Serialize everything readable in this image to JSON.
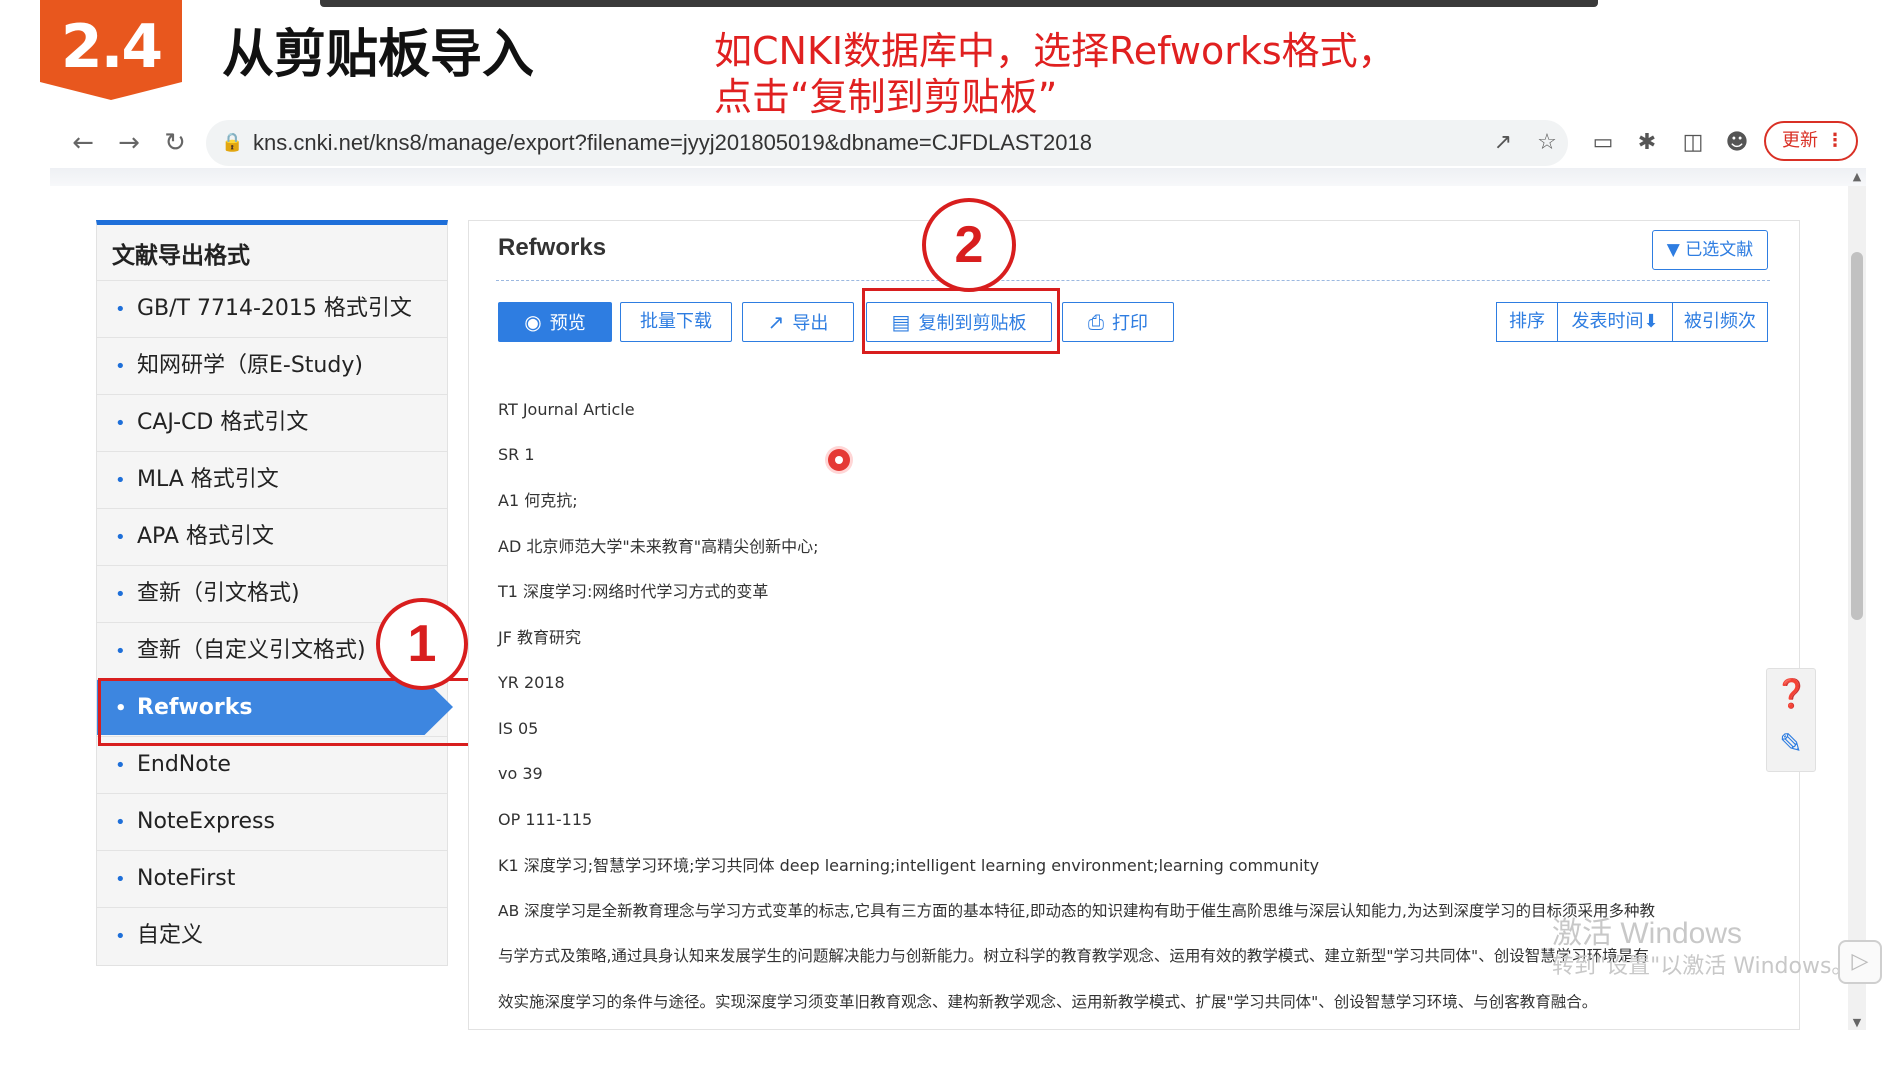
{
  "slide": {
    "badge": "2.4",
    "title": "从剪贴板导入",
    "note_line1": "如CNKI数据库中，选择Refworks格式，",
    "note_line2": "点击“复制到剪贴板”"
  },
  "browser": {
    "url": "kns.cnki.net/kns8/manage/export?filename=jyyj201805019&dbname=CJFDLAST2018",
    "update_label": "更新",
    "menu_glyph": "⋮",
    "icons": [
      "back-icon",
      "forward-icon",
      "reload-icon",
      "lock-icon",
      "share-icon",
      "star-icon",
      "doc-icon",
      "extensions-icon",
      "sidepanel-icon",
      "profile-icon"
    ]
  },
  "sidebar": {
    "heading": "文献导出格式",
    "items": [
      {
        "label": "GB/T 7714-2015 格式引文"
      },
      {
        "label": "知网研学（原E-Study)"
      },
      {
        "label": "CAJ-CD 格式引文"
      },
      {
        "label": "MLA 格式引文"
      },
      {
        "label": "APA 格式引文"
      },
      {
        "label": "查新（引文格式)"
      },
      {
        "label": "查新（自定义引文格式)"
      },
      {
        "label": "Refworks",
        "active": true
      },
      {
        "label": "EndNote"
      },
      {
        "label": "NoteExpress"
      },
      {
        "label": "NoteFirst"
      },
      {
        "label": "自定义"
      }
    ]
  },
  "annotations": {
    "step1": "1",
    "step2": "2"
  },
  "main": {
    "title": "Refworks",
    "selected_docs": "已选文献",
    "toolbar": {
      "preview": "预览",
      "batch_download": "批量下载",
      "export": "导出",
      "copy_clipboard": "复制到剪贴板",
      "print": "打印"
    },
    "sort": {
      "label": "排序",
      "by_date": "发表时间",
      "by_cited": "被引频次"
    },
    "record": [
      "RT Journal Article",
      "SR 1",
      "A1 何克抗;",
      "AD 北京师范大学\"未来教育\"高精尖创新中心;",
      "T1 深度学习:网络时代学习方式的变革",
      "JF 教育研究",
      "YR 2018",
      "IS 05",
      "vo 39",
      "OP 111-115",
      "K1 深度学习;智慧学习环境;学习共同体 deep learning;intelligent learning environment;learning community",
      "AB 深度学习是全新教育理念与学习方式变革的标志,它具有三方面的基本特征,即动态的知识建构有助于催生高阶思维与深层认知能力,为达到深度学习的目标须采用多种教",
      "与学方式及策略,通过具身认知来发展学生的问题解决能力与创新能力。树立科学的教育教学观念、运用有效的教学模式、建立新型\"学习共同体\"、创设智慧学习环境是有",
      "效实施深度学习的条件与途径。实现深度学习须变革旧教育观念、建构新教学观念、运用新教学模式、扩展\"学习共同体\"、创设智慧学习环境、与创客教育融合。"
    ]
  },
  "watermark": {
    "line1": "激活 Windows",
    "line2": "转到\"设置\"以激活 Windows。"
  },
  "colors": {
    "accent": "#2e7de1",
    "badge": "#e8571e",
    "annotation": "#d81e1e"
  }
}
